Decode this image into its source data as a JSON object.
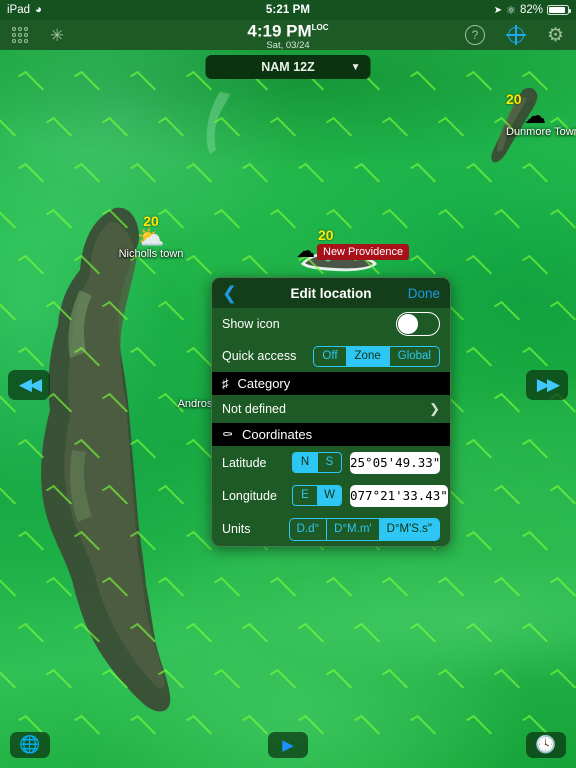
{
  "status_bar": {
    "device": "iPad",
    "wifi_icon": "wifi-icon",
    "time": "5:21 PM",
    "location_arrow_icon": "location-arrow-icon",
    "bluetooth_icon": "bluetooth-icon",
    "battery_percent": "82%"
  },
  "app_bar": {
    "apps_grid_icon": "apps-grid-icon",
    "star_icon": "star-icon",
    "clock_time": "4:19 PM",
    "clock_suffix": "LOC",
    "clock_date": "Sat, 03/24",
    "help_icon": "question-mark-icon",
    "locate_icon": "crosshair-target-icon",
    "settings_icon": "gear-icon",
    "accent_blue": "#1ea7f0"
  },
  "model_selector": {
    "value": "NAM 12Z",
    "caret_icon": "chevron-down-icon"
  },
  "map": {
    "pois": [
      {
        "name": "Nicholls town",
        "temp": "20",
        "wx_icon": "sun-cloud-icon",
        "style": "plain"
      },
      {
        "name": "New Providence",
        "temp": "20",
        "wx_icon": "cloud-icon",
        "style": "chip"
      },
      {
        "name": "Dunmore Town",
        "temp": "20",
        "wx_icon": "cloud-icon",
        "style": "plain"
      },
      {
        "name": "Andros",
        "temp": "",
        "wx_icon": "",
        "style": "plain"
      }
    ],
    "nav_prev_icon": "rewind-double-left-icon",
    "nav_next_icon": "fast-forward-double-right-icon"
  },
  "bottom_bar": {
    "globe_icon": "globe-layers-icon",
    "play_icon": "play-icon",
    "clock_icon": "clock-history-icon"
  },
  "dialog": {
    "back_icon": "chevron-left-icon",
    "title": "Edit location",
    "done_label": "Done",
    "show_icon": {
      "label": "Show icon",
      "toggle_state": "off"
    },
    "quick_access": {
      "label": "Quick access",
      "options": [
        "Off",
        "Zone",
        "Global"
      ],
      "selected": "Zone"
    },
    "category": {
      "section_icon": "hash-tag-icon",
      "section_title": "Category",
      "value": "Not defined",
      "chevron_icon": "chevron-right-icon"
    },
    "coordinates": {
      "section_icon": "globe-icon",
      "section_title": "Coordinates",
      "latitude": {
        "label": "Latitude",
        "hemispheres": [
          "N",
          "S"
        ],
        "selected_hemisphere": "N",
        "value": "25°05'49.33\""
      },
      "longitude": {
        "label": "Longitude",
        "hemispheres": [
          "E",
          "W"
        ],
        "selected_hemisphere": "W",
        "value": "077°21'33.43\""
      },
      "units": {
        "label": "Units",
        "options": [
          "D.d°",
          "D°M.m'",
          "D°M'S.s\""
        ],
        "selected": "D°M'S.s\""
      }
    },
    "accent_blue": "#2ec6f5"
  }
}
